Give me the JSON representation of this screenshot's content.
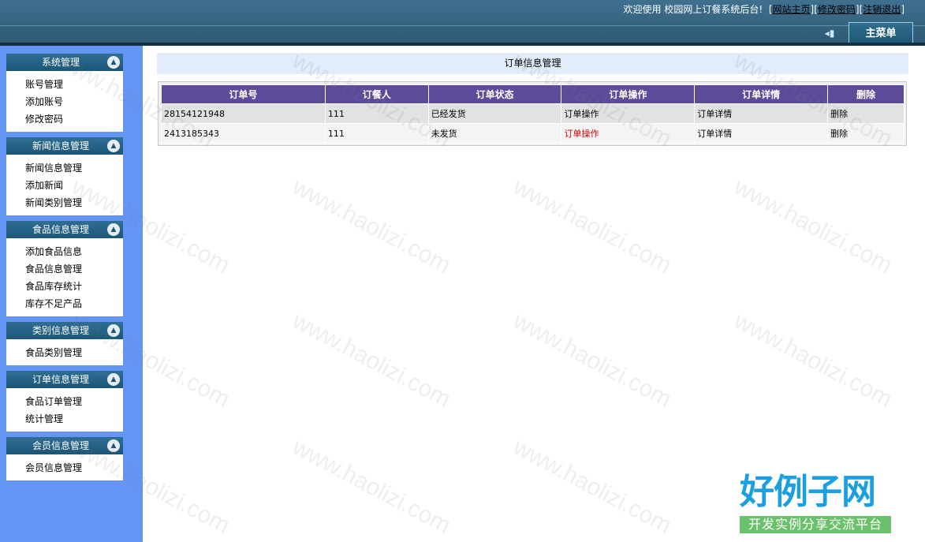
{
  "header": {
    "welcome_text": "欢迎使用 校园网上订餐系统后台!",
    "links": [
      "网站主页",
      "修改密码",
      "注销退出"
    ],
    "main_menu_label": "主菜单"
  },
  "sidebar": {
    "groups": [
      {
        "title": "系统管理",
        "items": [
          "账号管理",
          "添加账号",
          "修改密码"
        ]
      },
      {
        "title": "新闻信息管理",
        "items": [
          "新闻信息管理",
          "添加新闻",
          "新闻类别管理"
        ]
      },
      {
        "title": "食品信息管理",
        "items": [
          "添加食品信息",
          "食品信息管理",
          "食品库存统计",
          "库存不足产品"
        ]
      },
      {
        "title": "类别信息管理",
        "items": [
          "食品类别管理"
        ]
      },
      {
        "title": "订单信息管理",
        "items": [
          "食品订单管理",
          "统计管理"
        ]
      },
      {
        "title": "会员信息管理",
        "items": [
          "会员信息管理"
        ]
      }
    ]
  },
  "main": {
    "title": "订单信息管理",
    "table": {
      "headers": [
        "订单号",
        "订餐人",
        "订单状态",
        "订单操作",
        "订单详情",
        "删除"
      ],
      "rows": [
        {
          "order_no": "28154121948",
          "customer": "111",
          "status": "已经发货",
          "operation": "订单操作",
          "detail": "订单详情",
          "delete": "删除"
        },
        {
          "order_no": "2413185343",
          "customer": "111",
          "status": "未发货",
          "operation": "订单操作",
          "detail": "订单详情",
          "delete": "删除"
        }
      ]
    }
  },
  "watermark": {
    "text": "www.haolizi.com",
    "logo_title": "好例子网",
    "logo_subtitle": "开发实例分享交流平台"
  },
  "colors": {
    "header_bg": "#3a6a89",
    "sidebar_bg": "#6495f5",
    "table_header_bg": "#5d4b9a",
    "highlight_text": "#d40000"
  }
}
